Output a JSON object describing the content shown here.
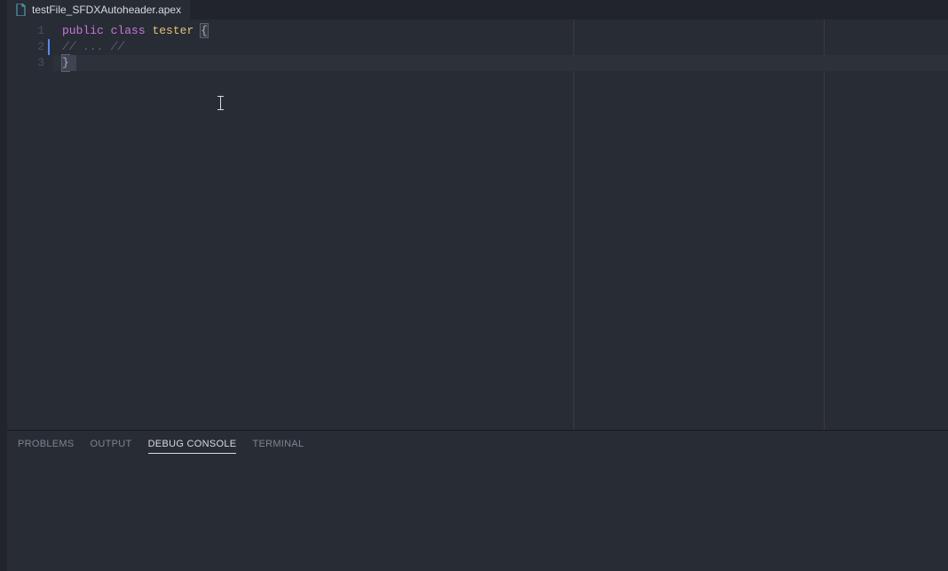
{
  "tab": {
    "filename": "testFile_SFDXAutoheader.apex"
  },
  "gutter": {
    "ln1": "1",
    "ln2": "2",
    "ln3": "3"
  },
  "code": {
    "line1": {
      "kw_public": "public",
      "sp1": " ",
      "kw_class": "class",
      "sp2": " ",
      "classname": "tester",
      "sp3": " ",
      "brace_open": "{"
    },
    "line2": {
      "comment": "// ... //"
    },
    "line3": {
      "brace_close": "}"
    }
  },
  "panel": {
    "tabs": {
      "problems": "PROBLEMS",
      "output": "OUTPUT",
      "debug_console": "DEBUG CONSOLE",
      "terminal": "TERMINAL"
    }
  }
}
